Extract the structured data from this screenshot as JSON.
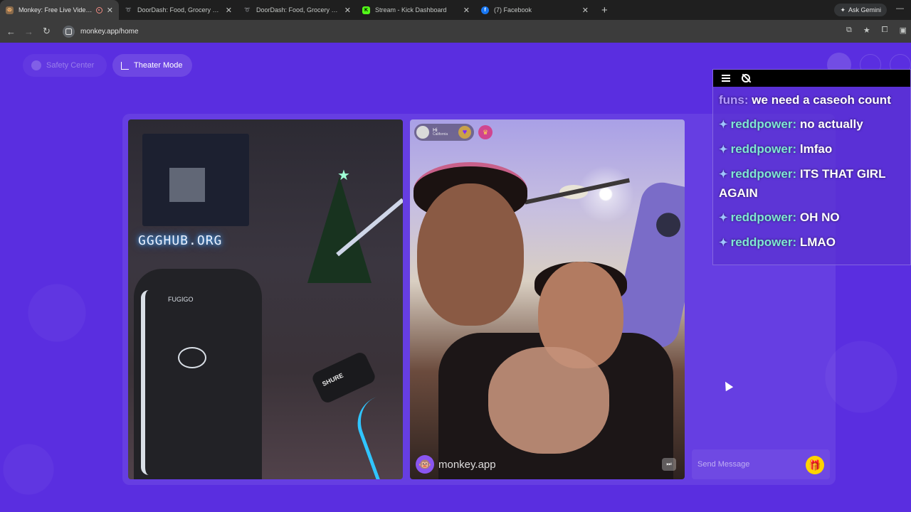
{
  "browser": {
    "tabs": [
      {
        "title": "Monkey: Free Live Video Ch",
        "favicon": "monkey",
        "color": "#8a6a4a",
        "active": true,
        "recording": true
      },
      {
        "title": "DoorDash: Food, Grocery and ",
        "favicon": "doordash",
        "color": "#ff3008",
        "active": false,
        "recording": false
      },
      {
        "title": "DoorDash: Food, Grocery and ",
        "favicon": "doordash",
        "color": "#ff3008",
        "active": false,
        "recording": false
      },
      {
        "title": "Stream - Kick Dashboard",
        "favicon": "kick",
        "color": "#53fc18",
        "active": false,
        "recording": false
      },
      {
        "title": "(7) Facebook",
        "favicon": "facebook",
        "color": "#1877f2",
        "active": false,
        "recording": false
      }
    ],
    "gemini_label": "Ask Gemini",
    "url": "monkey.app/home"
  },
  "page": {
    "safety_label": "Safety Center",
    "theater_label": "Theater Mode",
    "location_pill": {
      "line1": "Hi",
      "line2": "California"
    },
    "brand_label": "monkey.app",
    "chat_placeholder": "Send Message",
    "bg_color": "#5a2ee0"
  },
  "overlay_chat": {
    "messages": [
      {
        "user": "funs",
        "text": "we need a caseoh count",
        "badge": false
      },
      {
        "user": "reddpower",
        "text": "no actually",
        "badge": true
      },
      {
        "user": "reddpower",
        "text": "lmfao",
        "badge": true
      },
      {
        "user": "reddpower",
        "text": "ITS THAT GIRL AGAIN",
        "badge": true
      },
      {
        "user": "reddpower",
        "text": "OH NO",
        "badge": true
      },
      {
        "user": "reddpower",
        "text": "LMAO",
        "badge": true
      }
    ]
  },
  "stream_overlay": {
    "neon_sign": "GGGHUB.ORG",
    "chair_text": "FUGIGO",
    "mic_text": "SHURE"
  }
}
